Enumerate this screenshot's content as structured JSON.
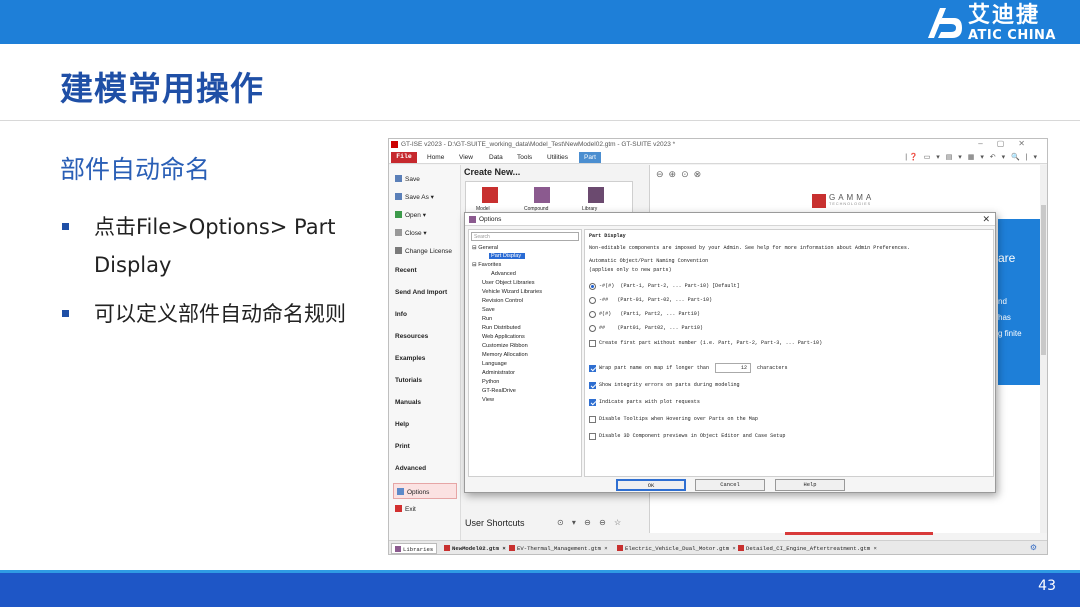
{
  "slide": {
    "brand_cn": "艾迪捷",
    "brand_en": "ATIC CHINA",
    "title": "建模常用操作",
    "subtitle": "部件自动命名",
    "bullets": [
      "点击File>Options> Part Display",
      "可以定义部件自动命名规则"
    ],
    "page_number": "43"
  },
  "app": {
    "window_title": "GT-ISE v2023 - D:\\GT-SUITE_working_data\\Model_Test\\NewModel02.gtm - GT-SUITE v2023 *",
    "menu": [
      "File",
      "Home",
      "View",
      "Data",
      "Tools",
      "Utilities",
      "Part"
    ],
    "sidebar": [
      "Save",
      "Save As",
      "Open",
      "Close",
      "Change License",
      "Recent",
      "Send And Import",
      "Info",
      "Resources",
      "Examples",
      "Tutorials",
      "Manuals",
      "Help",
      "Print",
      "Advanced",
      "Options",
      "Exit"
    ],
    "create_new": "Create New...",
    "create_icons": [
      "Model",
      "Compound",
      "Library"
    ],
    "user_shortcuts": "User Shortcuts",
    "gamma_logo": "GAMMA",
    "gamma_sub": "TECHNOLOGIES",
    "bluebox_text": [
      "are",
      "nd",
      "has",
      "g finite"
    ],
    "file_tabs": [
      "Libraries",
      "NewModel02.gtm ×",
      "EV-Thermal_Management.gtm ×",
      "Electric_Vehicle_Dual_Motor.gtm ×",
      "Detailed_CI_Engine_Aftertreatment.gtm ×"
    ]
  },
  "dialog": {
    "title": "Options",
    "search_placeholder": "Search",
    "tree": [
      "General",
      "Part Display",
      "Favorites",
      "Advanced",
      "User Object Libraries",
      "Vehicle Wizard Libraries",
      "Revision Control",
      "Save",
      "Run",
      "Run Distributed",
      "Web Applications",
      "Customize Ribbon",
      "Memory Allocation",
      "Language",
      "Administrator",
      "Python",
      "GT-RealDrive",
      "View"
    ],
    "heading": "Part Display",
    "admin_note": "Non-editable components are imposed by your Admin.  See help for more information about Admin Preferences.",
    "naming_title": "Automatic Object/Part Naming Convention",
    "naming_note": "(applies only to new parts)",
    "options": [
      {
        "code": "-#(#)",
        "example": "(Part-1,  Part-2, ... Part-10) [Default]",
        "selected": true
      },
      {
        "code": "-##",
        "example": "(Part-01, Part-02, ... Part-10)",
        "selected": false
      },
      {
        "code": "#(#)",
        "example": "(Part1,   Part2,  ... Part10)",
        "selected": false
      },
      {
        "code": "##",
        "example": "(Part01,  Part02, ... Part10)",
        "selected": false
      }
    ],
    "first_part": "Create first part without number (i.e. Part, Part-2, Part-3, ... Part-10)",
    "wrap_label": "Wrap part name on map if longer than",
    "wrap_value": "12",
    "wrap_unit": "characters",
    "integrity": "Show integrity errors on parts during modeling",
    "plot_requests": "Indicate parts with plot requests",
    "disable_tooltips": "Disable Tooltips when Hovering over Parts on the Map",
    "disable_3d": "Disable 3D Component previews in Object Editor and Case Setup",
    "btn_ok": "OK",
    "btn_cancel": "Cancel",
    "btn_help": "Help"
  }
}
